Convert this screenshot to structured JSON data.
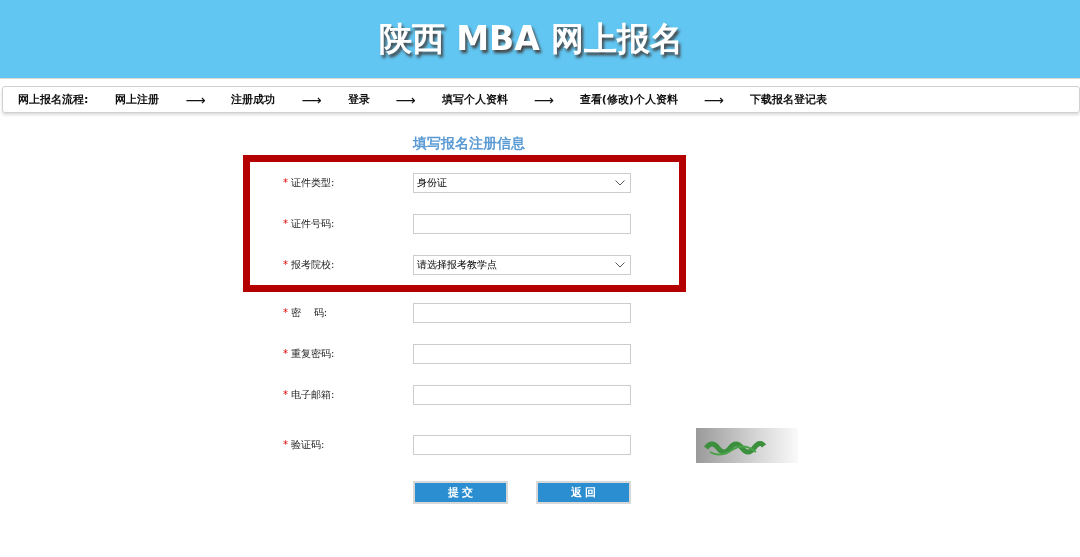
{
  "header": {
    "title": "陕西 MBA 网上报名"
  },
  "process_bar": {
    "heading": "网上报名流程:",
    "items": [
      {
        "kind": "step",
        "text": "网上注册"
      },
      {
        "kind": "arrow",
        "text": "⟶"
      },
      {
        "kind": "step",
        "text": "注册成功"
      },
      {
        "kind": "arrow",
        "text": "⟶"
      },
      {
        "kind": "step",
        "text": "登录"
      },
      {
        "kind": "arrow",
        "text": "⟶"
      },
      {
        "kind": "step",
        "text": "填写个人资料"
      },
      {
        "kind": "arrow",
        "text": "⟶"
      },
      {
        "kind": "step",
        "text": "查看(修改)个人资料"
      },
      {
        "kind": "arrow",
        "text": "⟶"
      },
      {
        "kind": "step",
        "text": "下载报名登记表"
      }
    ]
  },
  "form": {
    "title": "填写报名注册信息",
    "highlight_frame": {
      "fields": [
        {
          "kind": "select",
          "required": "*",
          "label": "证件类型:",
          "value": "身份证"
        },
        {
          "kind": "text",
          "required": "*",
          "label": "证件号码:"
        },
        {
          "kind": "select",
          "required": "*",
          "label": "报考院校:",
          "value": "请选择报考教学点"
        }
      ]
    },
    "fields": [
      {
        "kind": "text",
        "required": "*",
        "label": "密    码:"
      },
      {
        "kind": "text",
        "required": "*",
        "label": "重复密码:"
      },
      {
        "kind": "text",
        "required": "*",
        "label": "电子邮箱:"
      },
      {
        "kind": "captcha",
        "required": "*",
        "label": "验证码:"
      }
    ],
    "buttons": [
      "提 交",
      "返 回"
    ]
  }
}
